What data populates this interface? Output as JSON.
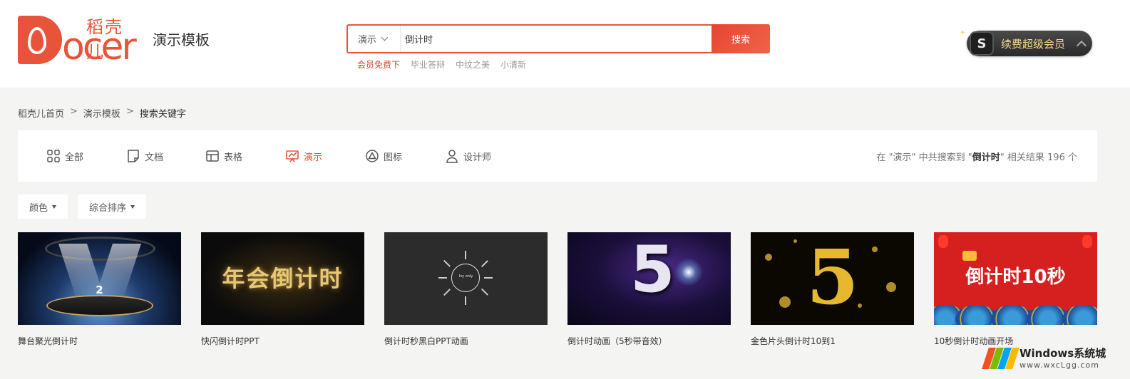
{
  "header": {
    "logo_cn": "稻壳儿",
    "logo_en": "Docer",
    "section_title": "演示模板",
    "search": {
      "category": "演示",
      "query": "倒计时",
      "button_label": "搜索"
    },
    "hot_tags": [
      "会员免费下",
      "毕业答辩",
      "中纹之美",
      "小清新"
    ],
    "vip_label": "续费超级会员",
    "vip_badge": "S"
  },
  "breadcrumb": {
    "items": [
      "稻壳儿首页",
      "演示模板",
      "搜索关键字"
    ],
    "separator": ">"
  },
  "filter_tabs": [
    {
      "label": "全部",
      "icon": "grid-icon",
      "active": false
    },
    {
      "label": "文档",
      "icon": "document-icon",
      "active": false
    },
    {
      "label": "表格",
      "icon": "table-icon",
      "active": false
    },
    {
      "label": "演示",
      "icon": "presentation-icon",
      "active": true
    },
    {
      "label": "图标",
      "icon": "triangle-icon",
      "active": false
    },
    {
      "label": "设计师",
      "icon": "person-icon",
      "active": false
    }
  ],
  "result_summary": {
    "prefix": "在 \"演示\" 中共搜索到 \"",
    "keyword": "倒计时",
    "suffix": "\" 相关结果 196 个"
  },
  "sort_controls": {
    "color_label": "颜色",
    "sort_label": "综合排序"
  },
  "templates": [
    {
      "title": "舞台聚光倒计时",
      "thumb_text": "2"
    },
    {
      "title": "快闪倒计时PPT",
      "thumb_text": "年会倒计时"
    },
    {
      "title": "倒计时秒黑白PPT动画",
      "thumb_text": "Ivy only"
    },
    {
      "title": "倒计时动画（5秒带音效）",
      "thumb_text": "5"
    },
    {
      "title": "金色片头倒计时10到1",
      "thumb_text": "5"
    },
    {
      "title": "10秒倒计时动画开场",
      "thumb_text": "倒计时10秒"
    }
  ],
  "watermark": {
    "title": "Windows系统城",
    "url": "www.wxcLgg.com"
  },
  "colors": {
    "accent": "#e8543a",
    "vip_gold": "#f5d88a"
  }
}
